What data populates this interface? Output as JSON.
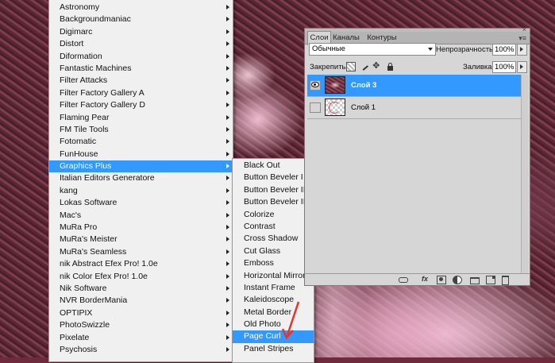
{
  "main_menu": {
    "items": [
      {
        "label": "Astronomy",
        "submenu": true
      },
      {
        "label": "Backgroundmaniac",
        "submenu": true
      },
      {
        "label": "Digimarc",
        "submenu": true
      },
      {
        "label": "Distort",
        "submenu": true
      },
      {
        "label": "Diformation",
        "submenu": true
      },
      {
        "label": "Fantastic Machines",
        "submenu": true
      },
      {
        "label": "Filter Attacks",
        "submenu": true
      },
      {
        "label": "Filter Factory Gallery A",
        "submenu": true
      },
      {
        "label": "Filter Factory Gallery D",
        "submenu": true
      },
      {
        "label": "Flaming Pear",
        "submenu": true
      },
      {
        "label": "FM Tile Tools",
        "submenu": true
      },
      {
        "label": "Fotomatic",
        "submenu": true
      },
      {
        "label": "FunHouse",
        "submenu": true
      },
      {
        "label": "Graphics Plus",
        "submenu": true,
        "selected": true
      },
      {
        "label": "Italian Editors Generatore",
        "submenu": true
      },
      {
        "label": "kang",
        "submenu": true
      },
      {
        "label": "Lokas Software",
        "submenu": true
      },
      {
        "label": "Mac's",
        "submenu": true
      },
      {
        "label": "MuRa Pro",
        "submenu": true
      },
      {
        "label": "MuRa's Meister",
        "submenu": true
      },
      {
        "label": "MuRa's Seamless",
        "submenu": true
      },
      {
        "label": "nik Abstract Efex Pro! 1.0e",
        "submenu": true
      },
      {
        "label": "nik Color Efex Pro! 1.0e",
        "submenu": true
      },
      {
        "label": "Nik Software",
        "submenu": true
      },
      {
        "label": "NVR BorderMania",
        "submenu": true
      },
      {
        "label": "OPTIPIX",
        "submenu": true
      },
      {
        "label": "PhotoSwizzle",
        "submenu": true
      },
      {
        "label": "Pixelate",
        "submenu": true
      },
      {
        "label": "Psychosis",
        "submenu": true
      }
    ]
  },
  "sub_menu": {
    "items": [
      {
        "label": "Black Out"
      },
      {
        "label": "Button Beveler I"
      },
      {
        "label": "Button Beveler II"
      },
      {
        "label": "Button Beveler III"
      },
      {
        "label": "Colorize"
      },
      {
        "label": "Contrast"
      },
      {
        "label": "Cross Shadow"
      },
      {
        "label": "Cut Glass"
      },
      {
        "label": "Emboss"
      },
      {
        "label": "Horizontal Mirror"
      },
      {
        "label": "Instant Frame"
      },
      {
        "label": "Kaleidoscope"
      },
      {
        "label": "Metal Border"
      },
      {
        "label": "Old Photo"
      },
      {
        "label": "Page Curl",
        "selected": true
      },
      {
        "label": "Panel Stripes"
      }
    ]
  },
  "layers_panel": {
    "tabs": [
      "Слои",
      "Каналы",
      "Контуры"
    ],
    "close_glyph": "×",
    "menu_glyph": "▾≡",
    "blend_mode": "Обычные",
    "opacity_label": "Непрозрачность:",
    "opacity_value": "100%",
    "lock_label": "Закрепить:",
    "fill_label": "Заливка:",
    "fill_value": "100%",
    "layers": [
      {
        "name": "Слой 3",
        "visible": true,
        "selected": true
      },
      {
        "name": "Слой 1",
        "visible": false,
        "selected": false
      }
    ],
    "bottom_icons": [
      "link-icon",
      "fx-icon",
      "mask-icon",
      "adjustment-icon",
      "folder-icon",
      "new-layer-icon",
      "trash-icon"
    ]
  },
  "colors": {
    "selection": "#3399ff",
    "menu_bg": "#f0f0f0",
    "panel_bg": "#d6d6d6",
    "pointer_arrow": "#e8352a"
  }
}
